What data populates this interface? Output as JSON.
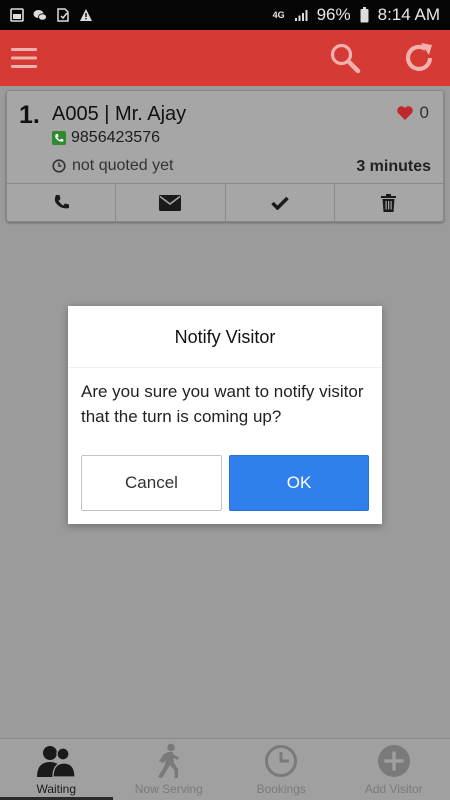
{
  "status_bar": {
    "network": "4G",
    "battery": "96%",
    "time": "8:14 AM",
    "icons": [
      "screenshot-icon",
      "wechat-icon",
      "sim-card-icon",
      "warning-icon",
      "signal-icon",
      "battery-icon"
    ]
  },
  "app_bar": {
    "background_color": "#d63a34",
    "icons": [
      "menu-icon",
      "search-icon",
      "refresh-icon"
    ]
  },
  "queue": [
    {
      "position": "1.",
      "title": "A005 | Mr. Ajay",
      "phone": "9856423576",
      "quote_status": "not quoted yet",
      "wait_time": "3 minutes",
      "likes": "0",
      "actions": [
        "phone-icon",
        "envelope-icon",
        "checkmark-icon",
        "trash-icon"
      ]
    }
  ],
  "dialog": {
    "title": "Notify Visitor",
    "message": "Are you sure you want to notify visitor that the turn is coming up?",
    "cancel_label": "Cancel",
    "ok_label": "OK",
    "ok_color": "#2f80ed"
  },
  "bottom_nav": [
    {
      "label": "Waiting",
      "icon": "people-icon",
      "active": true
    },
    {
      "label": "Now Serving",
      "icon": "walking-person-icon",
      "active": false
    },
    {
      "label": "Bookings",
      "icon": "clock-icon",
      "active": false
    },
    {
      "label": "Add Visitor",
      "icon": "plus-circle-icon",
      "active": false
    }
  ]
}
